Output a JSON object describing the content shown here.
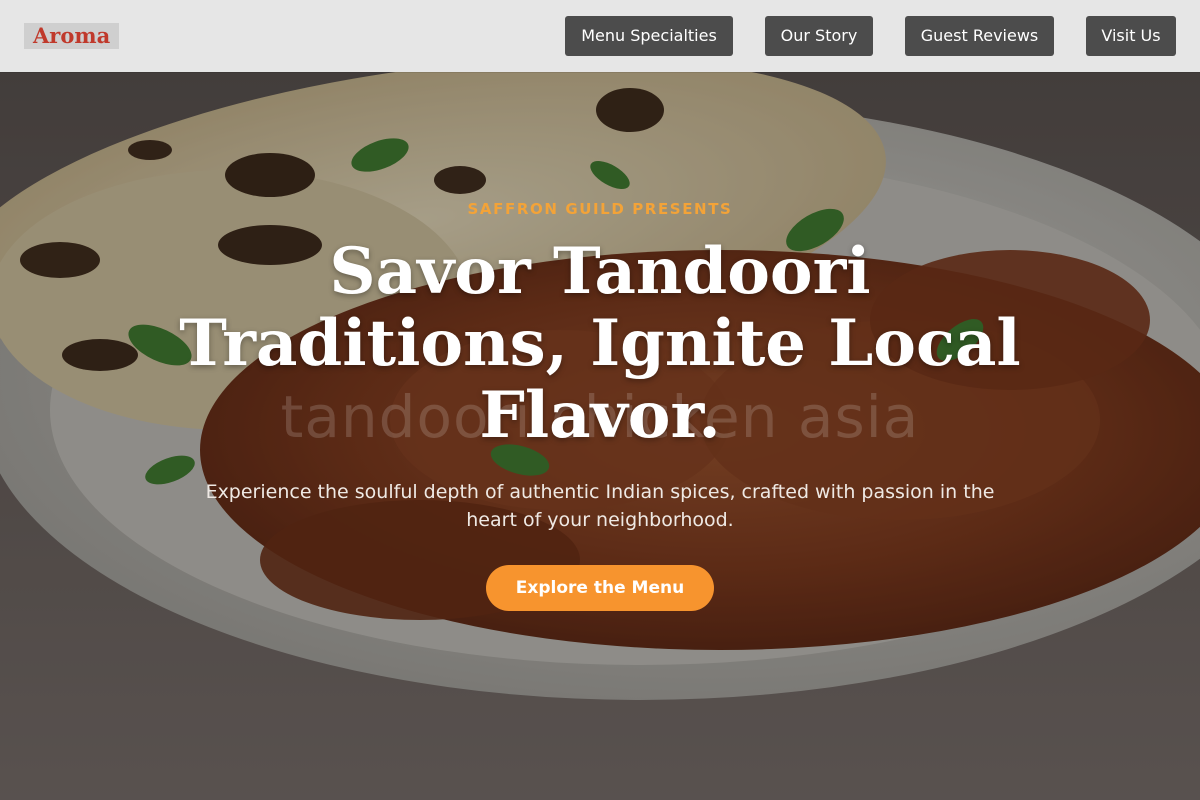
{
  "header": {
    "logo_text": "Aroma",
    "nav": [
      {
        "label": "Menu Specialties"
      },
      {
        "label": "Our Story"
      },
      {
        "label": "Guest Reviews"
      },
      {
        "label": "Visit Us"
      }
    ]
  },
  "hero": {
    "eyebrow": "SAFFRON GUILD PRESENTS",
    "headline": "Savor Tandoori Traditions, Ignite Local Flavor.",
    "subhead": "Experience the soulful depth of authentic Indian spices, crafted with passion in the heart of your neighborhood.",
    "cta_label": "Explore the Menu",
    "watermark_text": "tandoori chicken asia"
  },
  "colors": {
    "header_bg": "#e6e6e6",
    "logo_color": "#c0392b",
    "nav_bg": "#4c4c4c",
    "accent": "#f7942e",
    "eyebrow": "#f3a338"
  }
}
